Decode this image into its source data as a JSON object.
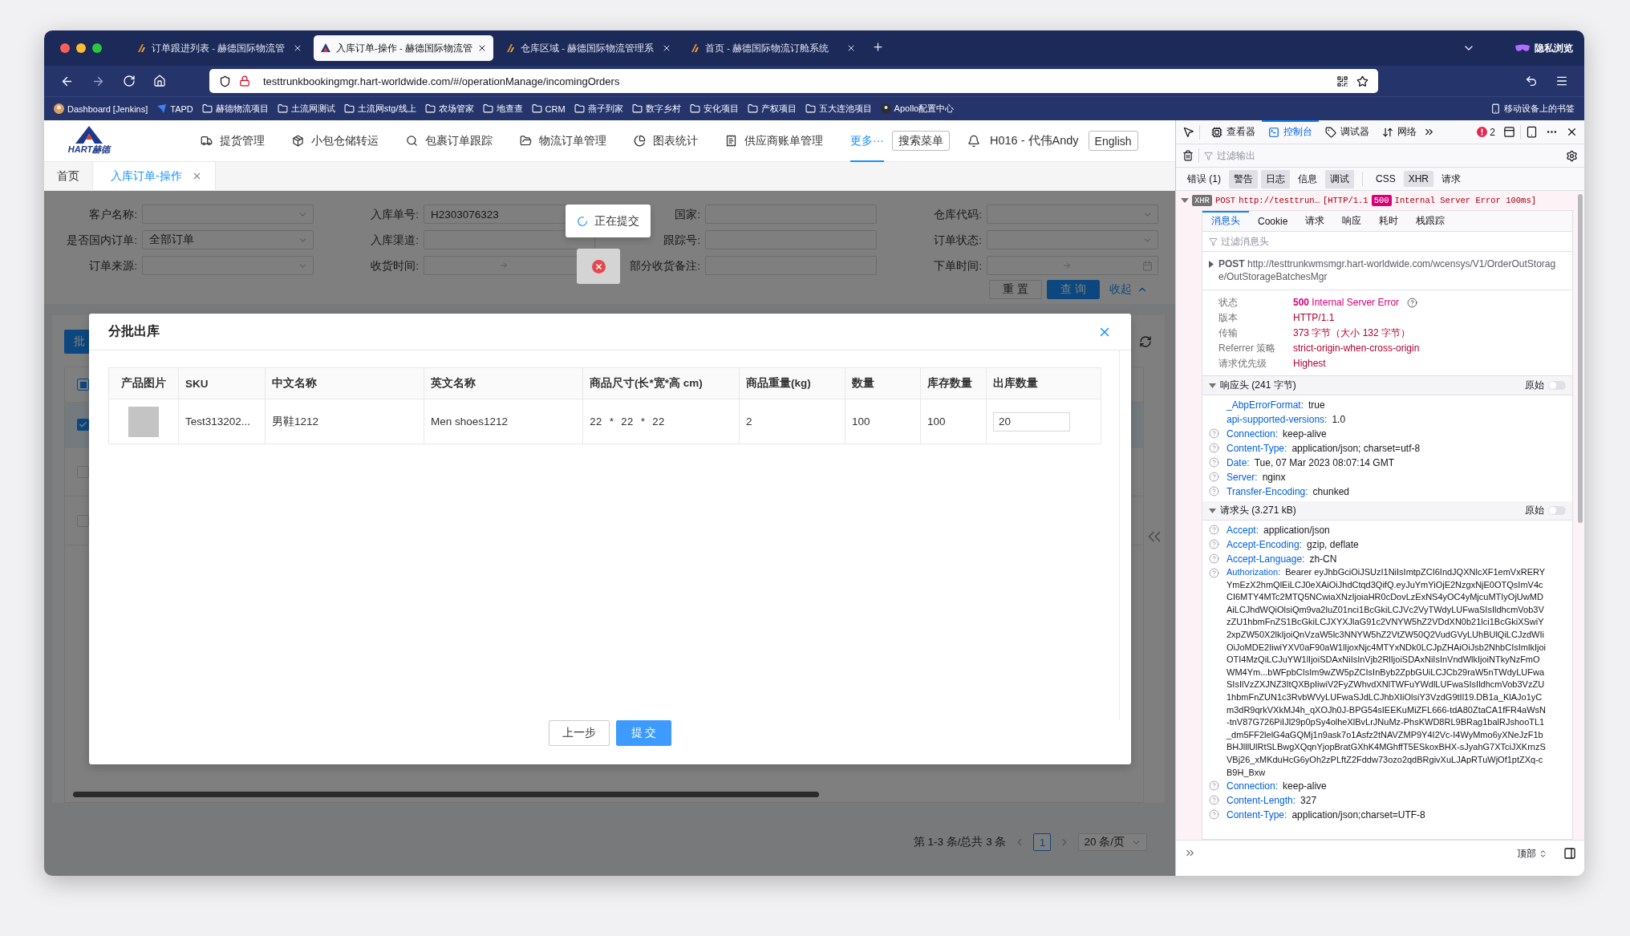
{
  "browser": {
    "tabs": [
      {
        "title": "订单跟进列表 - 赫德国际物流管",
        "selected": false
      },
      {
        "title": "入库订单-操作 - 赫德国际物流管",
        "selected": true
      },
      {
        "title": "仓库区域 - 赫德国际物流管理系",
        "selected": false
      },
      {
        "title": "首页 - 赫德国际物流订舱系统",
        "selected": false
      }
    ],
    "private_label": "隐私浏览",
    "url": "testtrunkbookingmgr.hart-worldwide.com/#/operationManage/incomingOrders",
    "bookmarks": [
      {
        "label": "Dashboard [Jenkins]",
        "kind": "avatar"
      },
      {
        "label": "TAPD",
        "kind": "tapd"
      },
      {
        "label": "赫德物流项目",
        "kind": "folder"
      },
      {
        "label": "土流网测试",
        "kind": "folder"
      },
      {
        "label": "土流网stg/线上",
        "kind": "folder"
      },
      {
        "label": "农场管家",
        "kind": "folder"
      },
      {
        "label": "地查查",
        "kind": "folder"
      },
      {
        "label": "CRM",
        "kind": "folder"
      },
      {
        "label": "燕子到家",
        "kind": "folder"
      },
      {
        "label": "数字乡村",
        "kind": "folder"
      },
      {
        "label": "安化项目",
        "kind": "folder"
      },
      {
        "label": "产权项目",
        "kind": "folder"
      },
      {
        "label": "五大连池项目",
        "kind": "folder"
      },
      {
        "label": "Apollo配置中心",
        "kind": "apollo"
      }
    ],
    "mobile_bookmarks": "移动设备上的书签"
  },
  "app": {
    "logo_text": "HART赫德",
    "nav": [
      {
        "label": "提货管理",
        "kind": "truck",
        "selected": false
      },
      {
        "label": "小包仓储转运",
        "kind": "box",
        "selected": false
      },
      {
        "label": "包裹订单跟踪",
        "kind": "search",
        "selected": false
      },
      {
        "label": "物流订单管理",
        "kind": "folder",
        "selected": false
      },
      {
        "label": "图表统计",
        "kind": "chart",
        "selected": false
      },
      {
        "label": "供应商账单管理",
        "kind": "bill",
        "selected": false
      },
      {
        "label": "更多···",
        "kind": "more",
        "selected": true
      }
    ],
    "search_menu": "搜索菜单",
    "user": "H016 - 代伟Andy",
    "language": "English",
    "page_tabs": [
      {
        "label": "首页",
        "selected": false,
        "closable": false
      },
      {
        "label": "入库订单-操作",
        "selected": true,
        "closable": true
      }
    ],
    "filters": [
      {
        "label": "客户名称:",
        "kind": "select"
      },
      {
        "label": "入库单号:",
        "kind": "text",
        "value": "H2303076323"
      },
      {
        "label": "国家:",
        "kind": "text"
      },
      {
        "label": "仓库代码:",
        "kind": "select"
      },
      {
        "label": "是否国内订单:",
        "kind": "select",
        "value": "全部订单"
      },
      {
        "label": "入库渠道:",
        "kind": "text"
      },
      {
        "label": "跟踪号:",
        "kind": "text"
      },
      {
        "label": "订单状态:",
        "kind": "select"
      },
      {
        "label": "订单来源:",
        "kind": "select"
      },
      {
        "label": "收货时间:",
        "kind": "daterange"
      },
      {
        "label": "部分收货备注:",
        "kind": "text"
      },
      {
        "label": "下单时间:",
        "kind": "daterange"
      }
    ],
    "filter_actions": {
      "reset": "重 置",
      "query": "查 询",
      "collapse": "收起"
    },
    "batch_button": "批",
    "header_checkbox": {
      "indeterminate": true
    },
    "row_checkboxes": [
      {
        "checked": true
      },
      {
        "checked": false
      },
      {
        "checked": false
      }
    ],
    "pagination": {
      "summary": "第 1-3 条/总共 3 条",
      "pages": [
        {
          "label": "1",
          "selected": true
        }
      ],
      "page_size": "20 条/页"
    },
    "loading": {
      "text": "正在提交"
    },
    "error_toast": {
      "visible": true
    },
    "modal": {
      "title": "分批出库",
      "columns": [
        "产品图片",
        "SKU",
        "中文名称",
        "英文名称",
        "商品尺寸(长*宽*高 cm)",
        "商品重量(kg)",
        "数量",
        "库存数量",
        "出库数量"
      ],
      "rows": [
        {
          "sku": "Test313202...",
          "name_cn": "男鞋1212",
          "name_en": "Men shoes1212",
          "size": "22 * 22 * 22",
          "weight": "2",
          "quantity": "100",
          "stock": "100",
          "out_quantity": "20"
        }
      ],
      "buttons": {
        "back": "上一步",
        "submit": "提 交"
      }
    }
  },
  "devtools": {
    "tabs": [
      {
        "label": "查看器",
        "kind": "inspector",
        "selected": false
      },
      {
        "label": "控制台",
        "kind": "console",
        "selected": true
      },
      {
        "label": "调试器",
        "kind": "debugger",
        "selected": false
      },
      {
        "label": "网络",
        "kind": "network",
        "selected": false
      }
    ],
    "error_count": "2",
    "filter_placeholder": "过滤输出",
    "levels": [
      {
        "label": "错误 (1)",
        "selected": false
      },
      {
        "label": "警告",
        "selected": true
      },
      {
        "label": "日志",
        "selected": true
      },
      {
        "label": "信息",
        "selected": false
      },
      {
        "label": "调试",
        "selected": true
      },
      {
        "label": "CSS",
        "selected": false
      },
      {
        "label": "XHR",
        "selected": true
      },
      {
        "label": "请求",
        "selected": false
      }
    ],
    "request": {
      "expanded": true,
      "badge": "XHR",
      "method": "POST",
      "url": "http://testtrun…",
      "protocol": "[HTTP/1.1",
      "status": "500",
      "status_text": "Internal Server Error 100ms]"
    },
    "detail_tabs": [
      {
        "label": "消息头",
        "selected": true
      },
      {
        "label": "Cookie",
        "selected": false
      },
      {
        "label": "请求",
        "selected": false
      },
      {
        "label": "响应",
        "selected": false
      },
      {
        "label": "耗时",
        "selected": false
      },
      {
        "label": "栈跟踪",
        "selected": false
      }
    ],
    "headers_filter_placeholder": "过滤消息头",
    "request_line": {
      "method": "POST",
      "url": "http://testtrunkwmsmgr.hart-worldwide.com/wcensys/V1/OrderOutStorage/OutStorageBatchesMgr"
    },
    "summary": [
      {
        "label": "状态",
        "value": "**500** Internal Server Error",
        "kind": "status"
      },
      {
        "label": "版本",
        "value": "HTTP/1.1",
        "kind": "value"
      },
      {
        "label": "传输",
        "value": "373 字节（大小 132 字节）",
        "kind": "value"
      },
      {
        "label": "Referrer 策略",
        "value": "strict-origin-when-cross-origin",
        "kind": "value"
      },
      {
        "label": "请求优先级",
        "value": "Highest",
        "kind": "value"
      }
    ],
    "sections": [
      {
        "title": "响应头 (241 字节)",
        "expanded": true,
        "raw_label": "原始",
        "raw": false,
        "items": [
          {
            "name": "_AbpErrorFormat:",
            "value": "true",
            "help": false
          },
          {
            "name": "api-supported-versions:",
            "value": "1.0",
            "help": false
          },
          {
            "name": "Connection:",
            "value": "keep-alive",
            "help": true
          },
          {
            "name": "Content-Type:",
            "value": "application/json; charset=utf-8",
            "help": true
          },
          {
            "name": "Date:",
            "value": "Tue, 07 Mar 2023 08:07:14 GMT",
            "help": true
          },
          {
            "name": "Server:",
            "value": "nginx",
            "help": true
          },
          {
            "name": "Transfer-Encoding:",
            "value": "chunked",
            "help": true
          }
        ]
      },
      {
        "title": "请求头 (3.271 kB)",
        "expanded": true,
        "raw_label": "原始",
        "raw": false,
        "items": [
          {
            "name": "Accept:",
            "value": "application/json",
            "help": true
          },
          {
            "name": "Accept-Encoding:",
            "value": "gzip, deflate",
            "help": true
          },
          {
            "name": "Accept-Language:",
            "value": "zh-CN",
            "help": true
          },
          {
            "name": "Authorization:",
            "value": "Bearer eyJhbGciOiJSUzI1NiIsImtpZCI6IndJQXNlcXF1emVxRERYYmEzX2hmQlEiLCJ0eXAiOiJhdCtqd3QifQ.eyJuYmYiOjE2NzgxNjE0OTQsImV4cCI6MTY4MTc2MTQ5NCwiaXNzIjoiaHR0cDovLzExNS4yOC4yMjcuMTIyOjUwMDAiLCJhdWQiOlsiQm9va2luZ01nci1BcGkiLCJVc2VyTWdyLUFwaSIsIldhcmVob3VzZU1hbmFnZS1BcGkiLCJXYXJlaG91c2VNYW5hZ2VDdXN0b21lci1BcGkiXSwiY2xpZW50X2lkIjoiQnVzaW5lc3NNYW5hZ2VtZW50Q2VudGVyLUhBUlQiLCJzdWIiOiJoMDE2IiwiYXV0aF90aW1lIjoxNjc4MTYxNDk0LCJpZHAiOiJsb2NhbCIsImlkIjoiOTI4MzQiLCJuYW1lIjoiSDAxNiIsInVjb2RlIjoiSDAxNiIsInVndWlkIjoiNTkyNzFmOWM4Ym...bWFpbCIsIm9wZW5pZCIsInByb2ZpbGUiLCJCb29raW5nTWdyLUFwaSIsIlVzZXJNZ3ItQXBpIiwiV2FyZWhvdXNlTWFuYWdlLUFwaSIsIldhcmVob3VzZU1hbmFnZUN1c3RvbWVyLUFwaSJdLCJhbXIiOlsiY3VzdG9tIl19.DB1a_KlAJo1yCm3dR9qrkVXkMJ4h_qXOJh0J-BPG54sIEEKuMiZFL666-tdA80ZtaCA1fFR4aWsN-tnV87G726PiIJl29p0pSy4olheXlBvLrJNuMz-PhsKWD8RL9BRag1balRJshooTL1_dm5FF2lelG4aGQMj1n9ask7o1Asfz2tNAVZMP9Y4I2Vc-I4WyMmo6yXNeJzF1bBHJlllUlRtSLBwgXQqnYjopBratGXhK4MGhffT5ESkoxBHX-sJyahG7XTciJXKrnzSVBj26_xMKduHcG6yOh2zPLftZ2Fddw73ozo2qdBRgivXuLJApRTuWjOf1ptZXq-cB9H_Bxw",
            "help": true
          },
          {
            "name": "Connection:",
            "value": "keep-alive",
            "help": true
          },
          {
            "name": "Content-Length:",
            "value": "327",
            "help": true
          },
          {
            "name": "Content-Type:",
            "value": "application/json;charset=UTF-8",
            "help": true
          }
        ]
      }
    ],
    "footer": {
      "position": "顶部"
    }
  }
}
